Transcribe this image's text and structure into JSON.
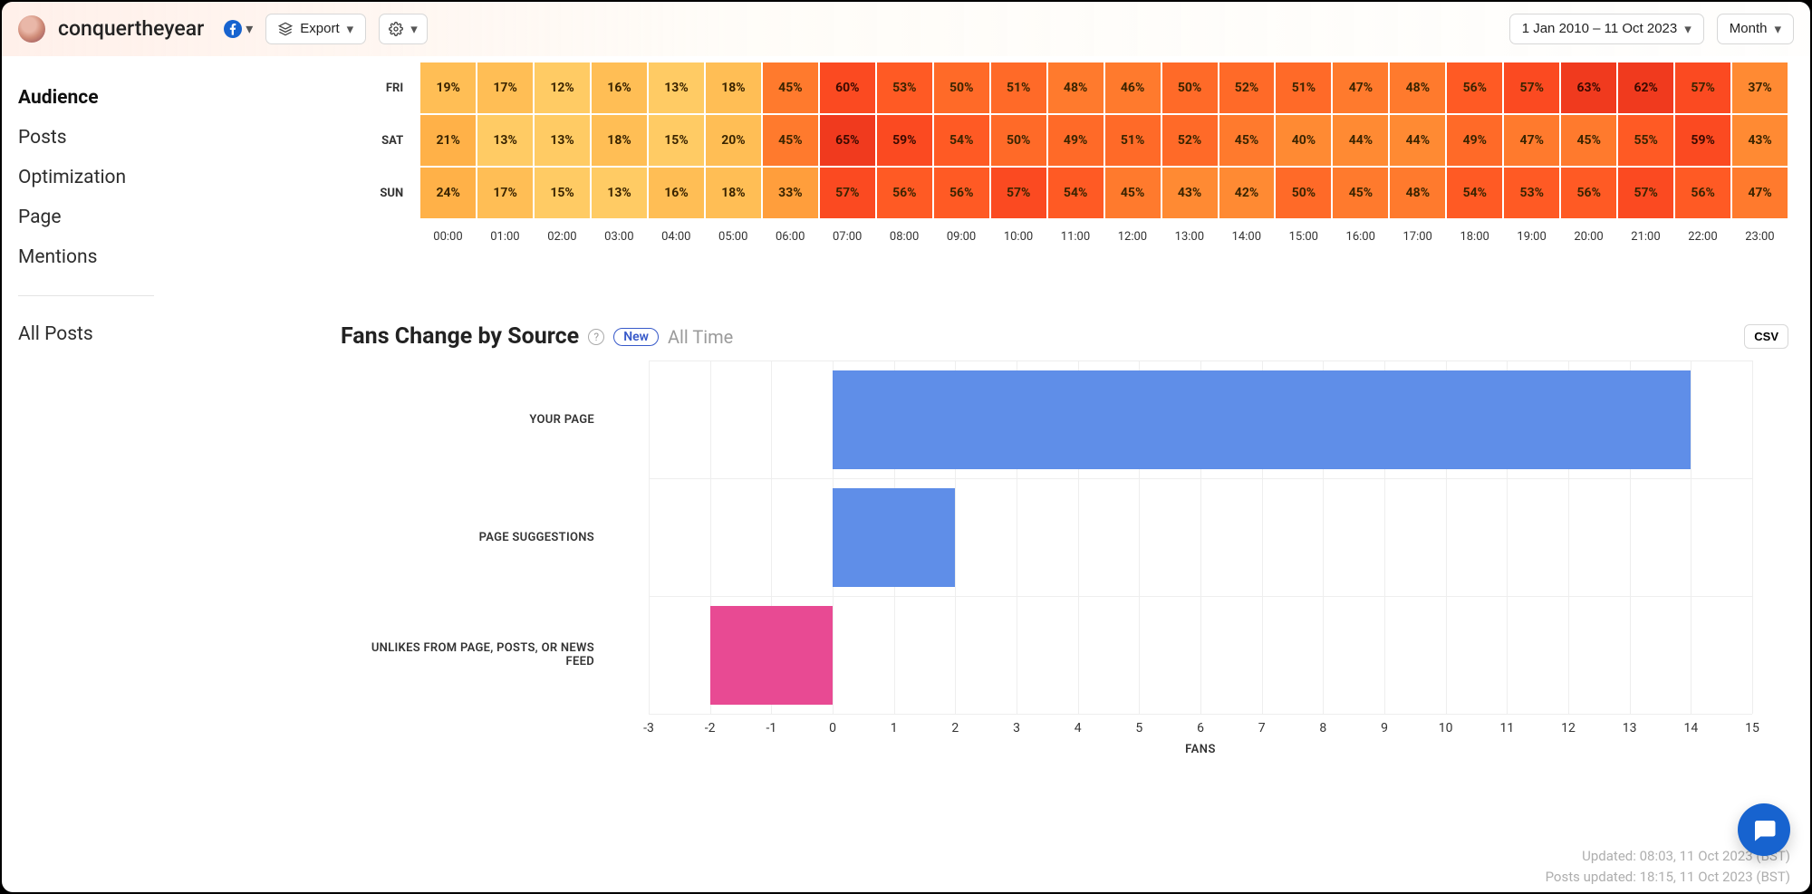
{
  "header": {
    "brand": "conquertheyear",
    "export_label": "Export",
    "date_range": "1 Jan 2010 – 11 Oct 2023",
    "granularity": "Month"
  },
  "sidebar": {
    "items": [
      {
        "label": "Audience",
        "active": true
      },
      {
        "label": "Posts",
        "active": false
      },
      {
        "label": "Optimization",
        "active": false
      },
      {
        "label": "Page",
        "active": false
      },
      {
        "label": "Mentions",
        "active": false
      }
    ],
    "separator_after": 4,
    "bottom_items": [
      {
        "label": "All Posts"
      }
    ]
  },
  "heatmap": {
    "hours": [
      "00:00",
      "01:00",
      "02:00",
      "03:00",
      "04:00",
      "05:00",
      "06:00",
      "07:00",
      "08:00",
      "09:00",
      "10:00",
      "11:00",
      "12:00",
      "13:00",
      "14:00",
      "15:00",
      "16:00",
      "17:00",
      "18:00",
      "19:00",
      "20:00",
      "21:00",
      "22:00",
      "23:00"
    ],
    "days": [
      "FRI",
      "SAT",
      "SUN"
    ],
    "values": [
      [
        19,
        17,
        12,
        16,
        13,
        18,
        45,
        60,
        53,
        50,
        51,
        48,
        46,
        50,
        52,
        51,
        47,
        48,
        56,
        57,
        63,
        62,
        57,
        37
      ],
      [
        21,
        13,
        13,
        18,
        15,
        20,
        45,
        65,
        59,
        54,
        50,
        49,
        51,
        52,
        45,
        40,
        44,
        44,
        49,
        47,
        45,
        55,
        59,
        43
      ],
      [
        24,
        17,
        15,
        13,
        16,
        18,
        33,
        57,
        56,
        56,
        57,
        54,
        45,
        43,
        42,
        50,
        45,
        48,
        54,
        53,
        56,
        57,
        56,
        47
      ]
    ]
  },
  "fans_section": {
    "title": "Fans Change by Source",
    "badge": "New",
    "subtitle": "All Time",
    "csv_label": "CSV"
  },
  "chart_data": {
    "type": "bar",
    "orientation": "horizontal",
    "xlabel": "FANS",
    "xlim": [
      -3,
      15
    ],
    "xticks": [
      -3,
      -2,
      -1,
      0,
      1,
      2,
      3,
      4,
      5,
      6,
      7,
      8,
      9,
      10,
      11,
      12,
      13,
      14,
      15
    ],
    "categories": [
      "YOUR PAGE",
      "PAGE SUGGESTIONS",
      "UNLIKES FROM PAGE, POSTS, OR NEWS FEED"
    ],
    "values": [
      14,
      2,
      -2
    ],
    "colors": [
      "#5f8ee8",
      "#5f8ee8",
      "#e84a93"
    ]
  },
  "footer": {
    "updated": "Updated: 08:03, 11 Oct 2023 (BST)",
    "posts_updated": "Posts updated: 18:15, 11 Oct 2023 (BST)"
  }
}
